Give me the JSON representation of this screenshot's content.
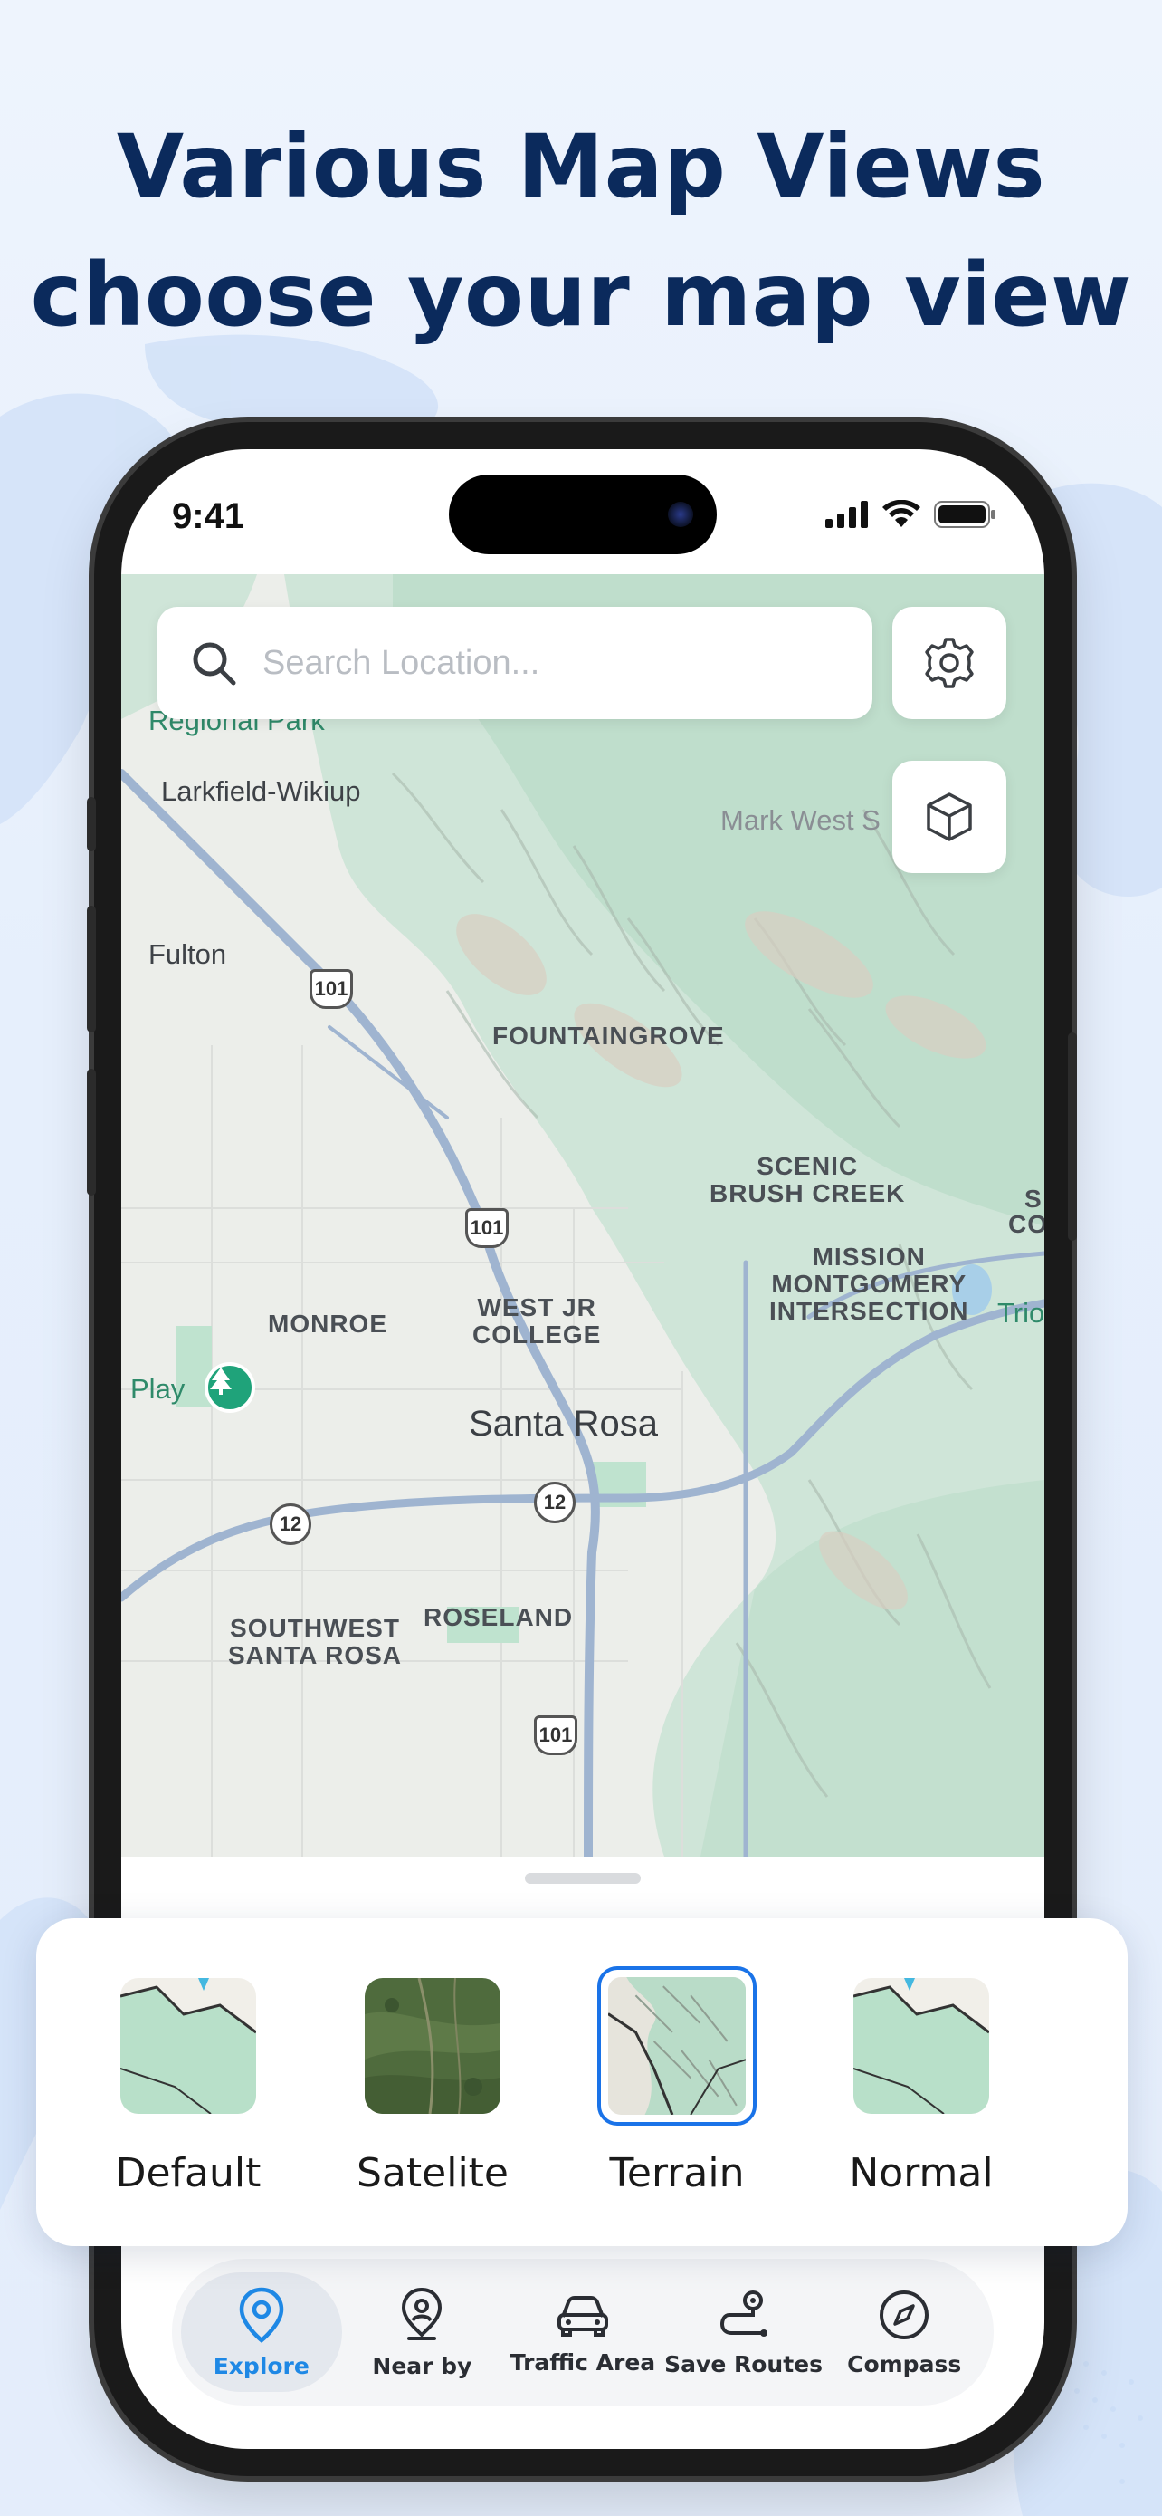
{
  "headline": {
    "line1": "Various Map Views",
    "line2": "choose your map view"
  },
  "status_bar": {
    "time": "9:41"
  },
  "search": {
    "placeholder": "Search Location..."
  },
  "map": {
    "labels": {
      "regional_park": "Regional Park",
      "larkfield": "Larkfield-Wikiup",
      "mark_west": "Mark West S",
      "fulton": "Fulton",
      "fountaingrove": "FOUNTAINGROVE",
      "scenic_line1": "SCENIC",
      "scenic_line2": "BRUSH CREEK",
      "mission_line1": "MISSION",
      "mission_line2": "MONTGOMERY",
      "mission_line3": "INTERSECTION",
      "monroe": "MONROE",
      "westjr_line1": "WEST JR",
      "westjr_line2": "COLLEGE",
      "play": "Play",
      "santa_rosa": "Santa Rosa",
      "southwest_line1": "SOUTHWEST",
      "southwest_line2": "SANTA ROSA",
      "roseland": "ROSELAND",
      "trio": "Trio",
      "right_s": "S",
      "right_co": "CO"
    },
    "shields": {
      "us101_a": "101",
      "us101_b": "101",
      "us101_c": "101",
      "ca12_a": "12",
      "ca12_b": "12"
    }
  },
  "map_styles": {
    "options": [
      {
        "label": "Default"
      },
      {
        "label": "Satelite"
      },
      {
        "label": "Terrain"
      },
      {
        "label": "Normal"
      }
    ],
    "selected": "Terrain"
  },
  "tabbar": {
    "tabs": [
      {
        "label": "Explore",
        "icon": "location-pin-icon"
      },
      {
        "label": "Near by",
        "icon": "nearby-pin-icon"
      },
      {
        "label": "Traffic Area",
        "icon": "car-icon"
      },
      {
        "label": "Save Routes",
        "icon": "route-icon"
      },
      {
        "label": "Compass",
        "icon": "compass-icon"
      }
    ],
    "active": "Explore"
  },
  "colors": {
    "headline": "#0b2a5c",
    "accent": "#1e88e5",
    "selected_border": "#1a73e8",
    "park_green": "#bfe3cf",
    "road_blue": "#9fb4d0"
  }
}
